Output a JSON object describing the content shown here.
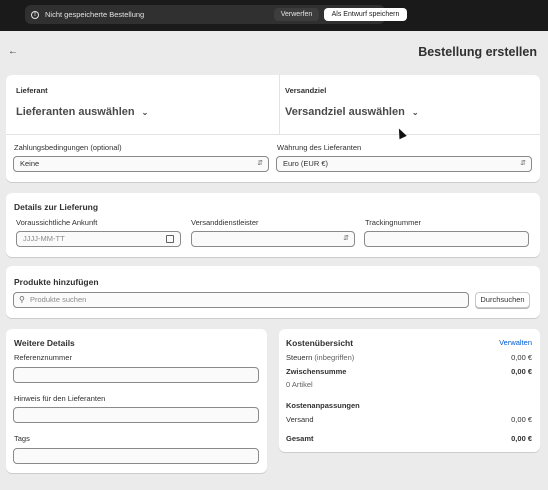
{
  "topbar": {
    "message": "Nicht gespeicherte Bestellung",
    "discard_label": "Verwerfen",
    "save_draft_label": "Als Entwurf speichern"
  },
  "header": {
    "back_icon": "arrow-left-icon",
    "title": "Bestellung erstellen"
  },
  "supplier_card": {
    "supplier_label": "Lieferant",
    "supplier_select": "Lieferanten auswählen",
    "destination_label": "Versandziel",
    "destination_select": "Versandziel auswählen",
    "payment_terms_label": "Zahlungsbedingungen (optional)",
    "payment_terms_value": "Keine",
    "currency_label": "Währung des Lieferanten",
    "currency_value": "Euro (EUR €)"
  },
  "shipping_card": {
    "title": "Details zur Lieferung",
    "arrival_label": "Voraussichtliche Ankunft",
    "arrival_placeholder": "JJJJ-MM-TT",
    "carrier_label": "Versanddienstleister",
    "carrier_value": "",
    "tracking_label": "Trackingnummer",
    "tracking_value": ""
  },
  "products_card": {
    "title": "Produkte hinzufügen",
    "search_placeholder": "Produkte suchen",
    "browse_label": "Durchsuchen"
  },
  "details_card": {
    "title": "Weitere Details",
    "reference_label": "Referenznummer",
    "note_label": "Hinweis für den Lieferanten",
    "tags_label": "Tags"
  },
  "summary_card": {
    "title": "Kostenübersicht",
    "manage_label": "Verwalten",
    "taxes_label": "Steuern",
    "taxes_sub": "(inbegriffen)",
    "taxes_value": "0,00 €",
    "subtotal_label": "Zwischensumme",
    "subtotal_value": "0,00 €",
    "items_count": "0 Artikel",
    "adjustments_title": "Kostenanpassungen",
    "shipping_label": "Versand",
    "shipping_value": "0,00 €",
    "total_label": "Gesamt",
    "total_value": "0,00 €"
  }
}
